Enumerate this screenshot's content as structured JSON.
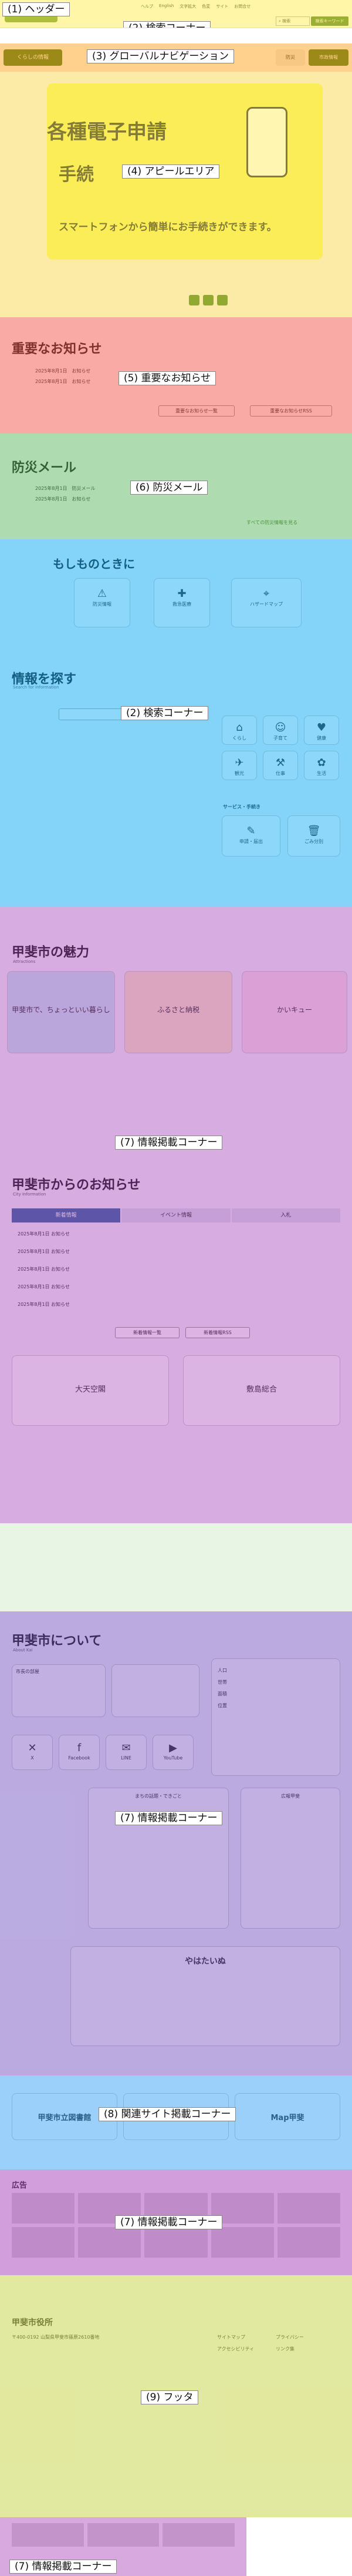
{
  "labels": {
    "l1": "(1) ヘッダー",
    "l2": "(2) 検索コーナー",
    "l3": "(3) グローバルナビゲーション",
    "l4": "(4) アピールエリア",
    "l5": "(5) 重要なお知らせ",
    "l6": "(6) 防災メール",
    "l7": "(7) 情報掲載コーナー",
    "l8": "(8) 関連サイト掲載コーナー",
    "l9": "(9) フッタ"
  },
  "header": {
    "links": [
      "ヘルプ",
      "English",
      "文字拡大",
      "色変",
      "サイト",
      "お問合せ"
    ],
    "search_placeholder": "検索",
    "search_button": "検索キーワード"
  },
  "nav": {
    "items": [
      "くらしの情報",
      "子育て・教育",
      "観光・文化",
      "市政情報",
      "事業者",
      "防災",
      "産業",
      "市政情報"
    ]
  },
  "appeal": {
    "title1": "各種電子申請",
    "title2": "手続",
    "subtitle": "スマートフォンから簡単にお手続きができます。"
  },
  "notice": {
    "title": "重要なお知らせ",
    "items": [
      {
        "date": "2025年8月1日",
        "text": "お知らせ"
      },
      {
        "date": "2025年8月1日",
        "text": "お知らせ"
      }
    ],
    "btn1": "重要なお知らせ一覧",
    "btn2": "重要なお知らせRSS"
  },
  "disaster": {
    "title": "防災メール",
    "items": [
      {
        "date": "2025年8月1日",
        "text": "防災メール"
      },
      {
        "date": "2025年8月1日",
        "text": "お知らせ"
      }
    ],
    "more": "すべての防災情報を見る"
  },
  "emergency": {
    "title": "もしものときに",
    "items": [
      "防災情報",
      "救急医療",
      "ハザードマップ"
    ]
  },
  "search": {
    "title": "情報を探す",
    "sub": "Search for information",
    "items": [
      "くらし",
      "子育て",
      "健康",
      "観光",
      "仕事",
      "生活"
    ]
  },
  "service": {
    "title": "サービス・手続き",
    "items": [
      "申請・届出",
      "ごみ分別"
    ]
  },
  "charm": {
    "title": "甲斐市の魅力",
    "sub": "Attractions",
    "cards": [
      "甲斐市で、ちょっといい暮らし",
      "ふるさと納税",
      "かいキュー"
    ]
  },
  "news": {
    "title": "甲斐市からのお知らせ",
    "sub": "City Information",
    "tabs": [
      "新着情報",
      "イベント情報",
      "入札"
    ],
    "items": [
      "2025年8月1日 お知らせ",
      "2025年8月1日 お知らせ",
      "2025年8月1日 お知らせ",
      "2025年8月1日 お知らせ",
      "2025年8月1日 お知らせ"
    ],
    "btn1": "新着情報一覧",
    "btn2": "新着情報RSS",
    "banner1": "大天空閣",
    "banner2": "敷島総合"
  },
  "about": {
    "title": "甲斐市について",
    "sub": "About Kai",
    "mayor": "市長の部屋",
    "stats": [
      "人口",
      "世帯",
      "面積",
      "位置"
    ],
    "sns": [
      "X",
      "Facebook",
      "LINE",
      "YouTube"
    ],
    "gallery": "まちの話題・できごと",
    "mascot": "やはたいぬ",
    "pr": "広報甲斐"
  },
  "related": {
    "items": [
      "甲斐市立図書館",
      "関連サイト",
      "Map甲斐"
    ]
  },
  "ads": {
    "title": "広告"
  },
  "footer": {
    "title": "甲斐市役所",
    "address": "〒400-0192 山梨県甲斐市篠原2610番地",
    "links": [
      "サイトマップ",
      "プライバシー",
      "アクセシビリティ",
      "リンク集"
    ]
  }
}
